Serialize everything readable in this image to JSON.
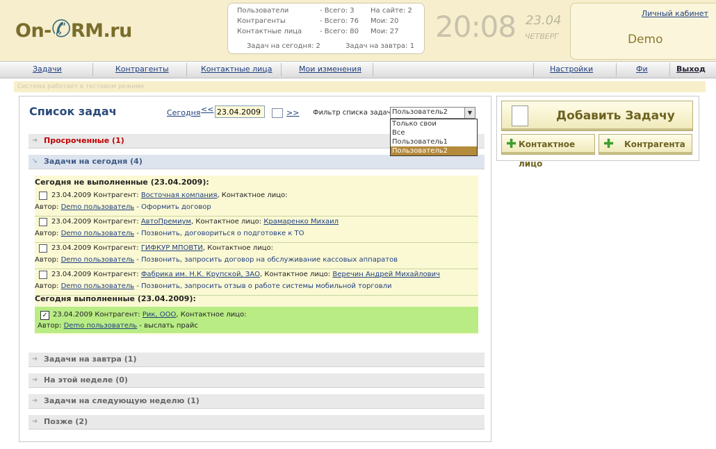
{
  "logo": {
    "text_left": "On-",
    "text_right": "RM.ru"
  },
  "stats": {
    "users_label": "Пользователи",
    "users_total": "- Всего: 3",
    "users_online": "На сайте: 2",
    "contractors_label": "Контрагенты",
    "contractors_total": "- Всего: 76",
    "contractors_mine": "Мои: 20",
    "contacts_label": "Контактные лица",
    "contacts_total": "- Всего: 80",
    "contacts_mine": "Мои: 27",
    "tasks_today": "Задач на сегодня: 2",
    "tasks_tomorrow": "Задач на завтра: 1"
  },
  "clock": {
    "time": "20:08",
    "day": "23.04",
    "weekday": "ЧЕТВЕРГ"
  },
  "user": {
    "cabinet_link": "Личный кабинет",
    "name": "Demo"
  },
  "nav": {
    "tasks": "Задачи",
    "contractors": "Контрагенты",
    "contacts": "Контактные лица",
    "my_changes": "Мои изменения",
    "settings": "Настройки",
    "fi": "Фи",
    "logout": "Выход"
  },
  "info_bar": "Система работает в тестовом режиме",
  "task_list": {
    "title": "Список задач",
    "today_link": "Сегодня",
    "prev": "<<",
    "date_value": "23.04.2009",
    "next": ">>",
    "filter_label": "Фильтр списка задач",
    "filter_selected": "Пользователь2",
    "filter_options": [
      "Только свои",
      "Все",
      "Пользователь1",
      "Пользователь2"
    ]
  },
  "groups": {
    "overdue": "Просроченные (1)",
    "today": "Задачи на сегодня (4)",
    "tomorrow": "Задачи на завтра (1)",
    "this_week": "На этой неделе (0)",
    "next_week": "Задачи на следующую неделю (1)",
    "later": "Позже (2)"
  },
  "today": {
    "not_done_head": "Сегодня не выполненные (23.04.2009):",
    "done_head": "Сегодня выполненные (23.04.2009):",
    "tasks": [
      {
        "date": "23.04.2009 Контрагент:",
        "contractor": "Восточная компания",
        "contact_label": ", Контактное лицо:",
        "contact": "",
        "author_label": "Автор:",
        "author": "Demo пользователь",
        "desc": " - Оформить договор"
      },
      {
        "date": "23.04.2009 Контрагент:",
        "contractor": "АвтоПремиум",
        "contact_label": ", Контактное лицо:",
        "contact": "Крамаренко Михаил",
        "author_label": "Автор:",
        "author": "Demo пользователь",
        "desc": " - Позвонить, договориться о подготовке к ТО"
      },
      {
        "date": "23.04.2009 Контрагент:",
        "contractor": "ГИФКУР МПОВТИ",
        "contact_label": ", Контактное лицо:",
        "contact": "",
        "author_label": "Автор:",
        "author": "Demo пользователь",
        "desc": " - Позвонить, запросить договор на обслуживание кассовых аппаратов"
      },
      {
        "date": "23.04.2009 Контрагент:",
        "contractor": "Фабрика им. Н.К. Крупской, ЗАО",
        "contact_label": ", Контактное лицо:",
        "contact": "Веречин Андрей Михайлович",
        "author_label": "Автор:",
        "author": "Demo пользователь",
        "desc": " - Позвонить, запросить отзыв о работе системы мобильной торговли"
      }
    ],
    "done": {
      "date": "23.04.2009 Контрагент:",
      "contractor": "Рик, ООО",
      "contact_label": ", Контактное лицо:",
      "author_label": "Автор:",
      "author": "Demo пользователь",
      "desc": " - выслать прайс"
    }
  },
  "side": {
    "add_task": "Добавить Задачу",
    "add_contact": "Контактное лицо",
    "add_company": "Контрагента"
  }
}
